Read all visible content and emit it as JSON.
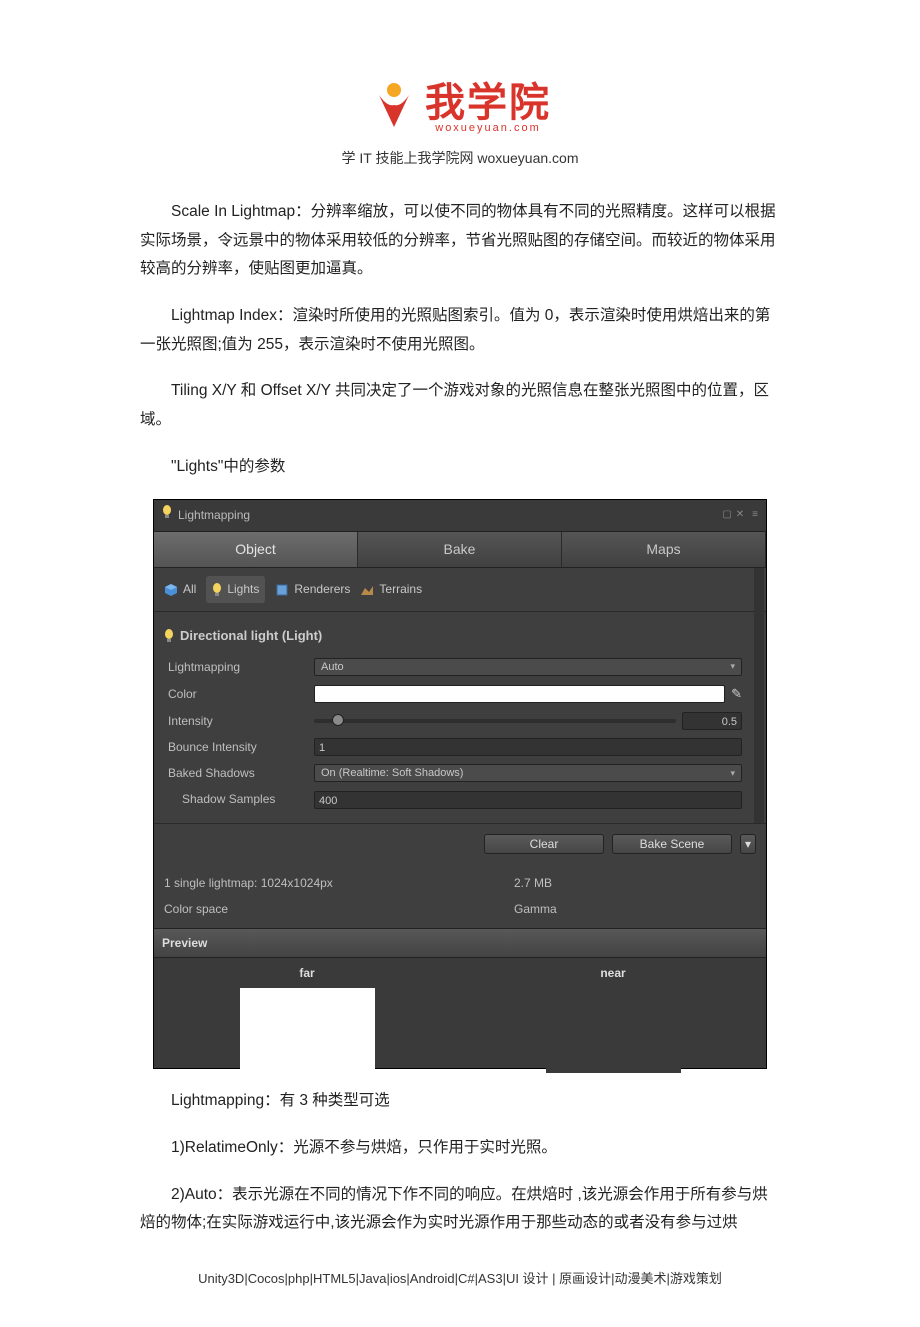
{
  "header": {
    "logo_text": "我学院",
    "logo_sub": "woxueyuan.com",
    "tagline": "学 IT 技能上我学院网 woxueyuan.com"
  },
  "doc": {
    "p1": "Scale In Lightmap：分辨率缩放，可以使不同的物体具有不同的光照精度。这样可以根据实际场景，令远景中的物体采用较低的分辨率，节省光照贴图的存储空间。而较近的物体采用较高的分辨率，使贴图更加逼真。",
    "p2": "Lightmap Index：渲染时所使用的光照贴图索引。值为 0，表示渲染时使用烘焙出来的第一张光照图;值为 255，表示渲染时不使用光照图。",
    "p3": "Tiling X/Y 和 Offset X/Y 共同决定了一个游戏对象的光照信息在整张光照图中的位置，区域。",
    "p4": "\"Lights\"中的参数",
    "p5": "Lightmapping：有 3 种类型可选",
    "p6": "1)RelatimeOnly：光源不参与烘焙，只作用于实时光照。",
    "p7": "2)Auto：表示光源在不同的情况下作不同的响应。在烘焙时 ,该光源会作用于所有参与烘焙的物体;在实际游戏运行中,该光源会作为实时光源作用于那些动态的或者没有参与过烘"
  },
  "unity": {
    "title": "Lightmapping",
    "tabs": {
      "object": "Object",
      "bake": "Bake",
      "maps": "Maps"
    },
    "filters": {
      "all": "All",
      "lights": "Lights",
      "renderers": "Renderers",
      "terrains": "Terrains"
    },
    "section": "Directional light (Light)",
    "props": {
      "lightmapping_label": "Lightmapping",
      "lightmapping_value": "Auto",
      "color_label": "Color",
      "intensity_label": "Intensity",
      "intensity_value": "0.5",
      "bounce_label": "Bounce Intensity",
      "bounce_value": "1",
      "shadows_label": "Baked Shadows",
      "shadows_value": "On (Realtime: Soft Shadows)",
      "samples_label": "Shadow Samples",
      "samples_value": "400"
    },
    "buttons": {
      "clear": "Clear",
      "bake": "Bake Scene"
    },
    "info": {
      "lm_label": "1 single lightmap: 1024x1024px",
      "lm_size": "2.7 MB",
      "cs_label": "Color space",
      "cs_value": "Gamma"
    },
    "preview": {
      "title": "Preview",
      "far": "far",
      "near": "near"
    }
  },
  "footer": "Unity3D|Cocos|php|HTML5|Java|ios|Android|C#|AS3|UI 设计 | 原画设计|动漫美术|游戏策划"
}
